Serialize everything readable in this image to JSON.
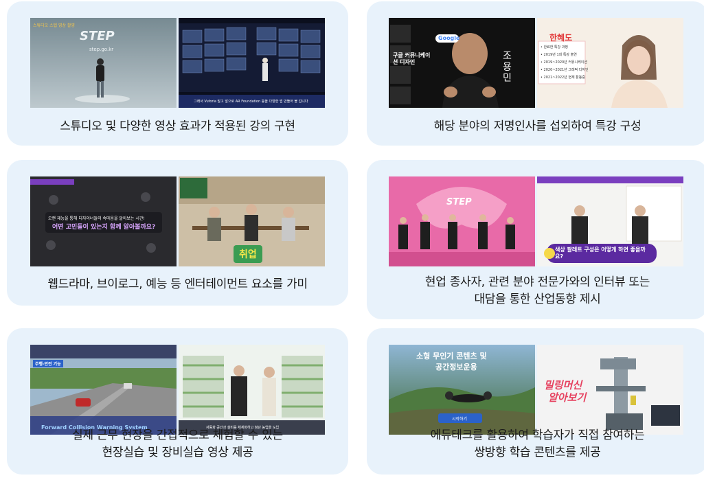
{
  "cards": [
    {
      "caption": [
        "스튜디오 및 다양한 영상 효과가 적용된 강의 구현"
      ],
      "thumb_left": {
        "logo": "STEP",
        "url": "step.go.kr",
        "tag": "스튜디오 스텝 영상 촬영"
      },
      "thumb_right": {
        "subtitle": "그래서 Vuforia 말고 앞으로 AR Foundation 등을 다양한 앱 만들어 볼 겁니다"
      }
    },
    {
      "caption": [
        "해당 분야의 저명인사를 섭외하여 특강 구성"
      ],
      "thumb_left": {
        "brand": "Google",
        "headline": "구글 커뮤니케이션 디자인",
        "name": "조용민"
      },
      "thumb_right": {
        "name": "한혜도",
        "lines": [
          "• 완료한 특강 과정",
          "• 2019년 1회 특강 출연",
          "• 2019~2020년 커뮤니케이션",
          "• 2020~2021년 그래픽 디자인",
          "• 2021~2022년 현재 활동중"
        ]
      }
    },
    {
      "caption": [
        "웹드라마, 브이로그, 예능 등 엔터테이먼트 요소를 가미"
      ],
      "thumb_left": {
        "line1": "오랜 재능을 통해 디자이너들의 속마음을 알아보는 시간!",
        "line2": "어떤 고민들이 있는지 함께 알아볼까요?"
      },
      "thumb_right": {
        "badge": "취업"
      }
    },
    {
      "caption": [
        "현업 종사자, 관련 분야 전문가와의 인터뷰 또는",
        "대담을 통한 산업동향 제시"
      ],
      "thumb_left": {
        "logo": "STEP"
      },
      "thumb_right": {
        "bubble": "색상 팔레트 구성은 어떻게 하면 좋을까요?"
      }
    },
    {
      "caption": [
        "실제 근무 현장을 간접적으로 체험할 수 있는",
        "현장실습 및 장비실습 영상 제공"
      ],
      "thumb_left": {
        "tag": "주행-안전 기능",
        "bottom": "Forward Collision Warning System"
      },
      "thumb_right": {
        "bottom": "자동화 공간과 설비를 체계화하고 첨단 농업을 도입"
      }
    },
    {
      "caption": [
        "에듀테크를 활용하여 학습자가 직접 참여하는",
        "쌍방향 학습 콘텐츠를 제공"
      ],
      "thumb_left": {
        "title1": "소형 무인기 콘텐츠 및",
        "title2": "공간정보운용",
        "button": "시작하기"
      },
      "thumb_right": {
        "title1": "밀링머신",
        "title2": "알아보기"
      }
    }
  ],
  "colors": {
    "card_bg": "#e8f2fb",
    "caption": "#1a1a1a"
  }
}
